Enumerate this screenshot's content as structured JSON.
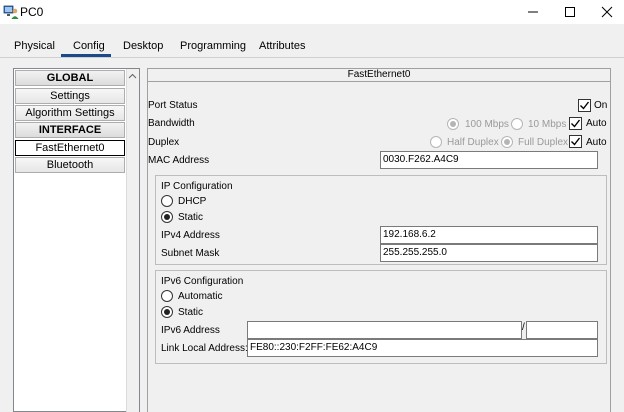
{
  "window": {
    "title": "PC0",
    "icon": "person-pc-icon",
    "controls": [
      "minimize-icon",
      "maximize-icon",
      "close-icon"
    ]
  },
  "tabs": [
    {
      "label": "Physical"
    },
    {
      "label": "Config"
    },
    {
      "label": "Desktop"
    },
    {
      "label": "Programming"
    },
    {
      "label": "Attributes"
    }
  ],
  "active_tab": "Config",
  "nav": {
    "global_header": "GLOBAL",
    "settings": "Settings",
    "algorithm": "Algorithm Settings",
    "interface_header": "INTERFACE",
    "fastethernet": "FastEthernet0",
    "bluetooth": "Bluetooth",
    "selected": "FastEthernet0"
  },
  "panel": {
    "header": "FastEthernet0",
    "port_status": {
      "label": "Port Status",
      "on_label": "On",
      "on_checked": true
    },
    "bandwidth": {
      "label": "Bandwidth",
      "opt1": "100 Mbps",
      "opt2": "10 Mbps",
      "auto_label": "Auto",
      "auto_checked": true
    },
    "duplex": {
      "label": "Duplex",
      "opt1": "Half Duplex",
      "opt2": "Full Duplex",
      "auto_label": "Auto",
      "auto_checked": true
    },
    "mac": {
      "label": "MAC Address",
      "value": "0030.F262.A4C9"
    },
    "ipv4": {
      "title": "IP Configuration",
      "dhcp": "DHCP",
      "static": "Static",
      "selected": "Static",
      "address_label": "IPv4 Address",
      "address_value": "192.168.6.2",
      "mask_label": "Subnet Mask",
      "mask_value": "255.255.255.0"
    },
    "ipv6": {
      "title": "IPv6 Configuration",
      "automatic": "Automatic",
      "static": "Static",
      "selected": "Static",
      "address_label": "IPv6 Address",
      "address_value": "",
      "prefix_value": "",
      "link_local_label": "Link Local Address:",
      "link_local_value": "FE80::230:F2FF:FE62:A4C9"
    }
  },
  "colors": {
    "tab_underline": "#1a4a8a",
    "background": "#f0f0f0"
  }
}
